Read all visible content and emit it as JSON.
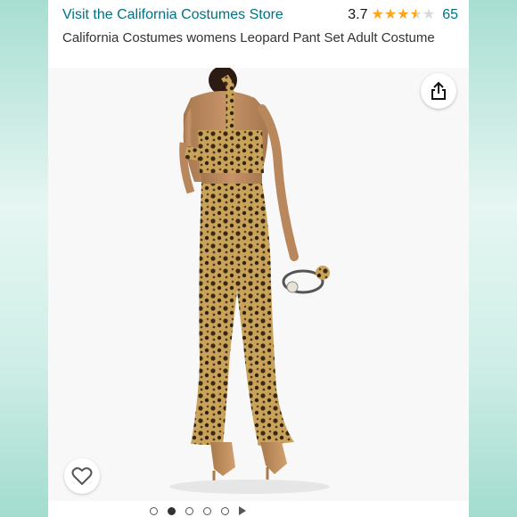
{
  "header": {
    "store_link": "Visit the California Costumes Store",
    "rating_value": "3.7",
    "rating_stars": 3.7,
    "rating_count": "65",
    "product_title": "California Costumes womens Leopard Pant Set Adult Costume"
  },
  "image": {
    "alt_subject": "leopard-costume-model-back-view"
  },
  "carousel": {
    "total_slides": 6,
    "active_index": 1
  },
  "icons": {
    "share": "share-icon",
    "heart": "heart-icon",
    "star": "star-icon",
    "play": "play-icon"
  },
  "colors": {
    "link": "#007185",
    "star": "#ffa41c",
    "side_teal": "#a8ded2"
  }
}
